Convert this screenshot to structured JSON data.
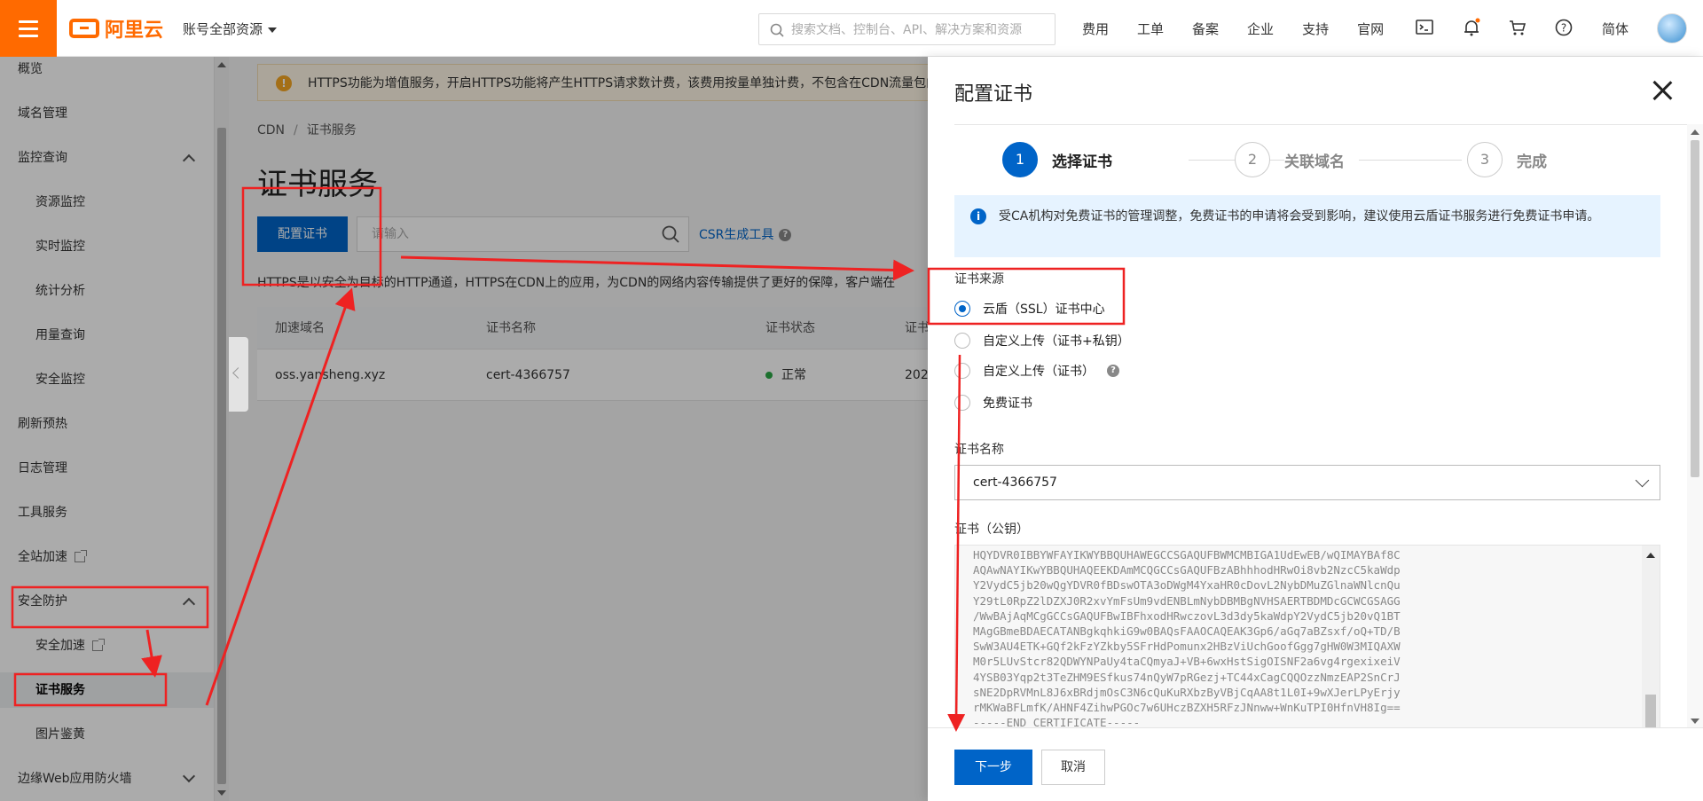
{
  "header": {
    "logo_text": "阿里云",
    "account_label": "账号全部资源",
    "search_placeholder": "搜索文档、控制台、API、解决方案和资源",
    "nav": [
      "费用",
      "工单",
      "备案",
      "企业",
      "支持",
      "官网"
    ],
    "lang": "简体",
    "accent_color": "#ff6a00"
  },
  "sidebar": {
    "items": [
      {
        "label": "概览"
      },
      {
        "label": "域名管理"
      },
      {
        "label": "监控查询"
      },
      {
        "label": "资源监控"
      },
      {
        "label": "实时监控"
      },
      {
        "label": "统计分析"
      },
      {
        "label": "用量查询"
      },
      {
        "label": "安全监控"
      },
      {
        "label": "刷新预热"
      },
      {
        "label": "日志管理"
      },
      {
        "label": "工具服务"
      },
      {
        "label": "全站加速"
      },
      {
        "label": "安全防护"
      },
      {
        "label": "安全加速"
      },
      {
        "label": "证书服务"
      },
      {
        "label": "图片鉴黄"
      },
      {
        "label": "边缘Web应用防火墙"
      }
    ]
  },
  "main": {
    "notice": "HTTPS功能为增值服务，开启HTTPS功能将产生HTTPS请求数计费，该费用按量单独计费，不包含在CDN流量包内。",
    "breadcrumb": [
      "CDN",
      "证书服务"
    ],
    "title": "证书服务",
    "config_button": "配置证书",
    "search_placeholder": "请输入",
    "csr_link": "CSR生成工具",
    "description": "HTTPS是以安全为目标的HTTP通道，HTTPS在CDN上的应用，为CDN的网络内容传输提供了更好的保障，客户端在",
    "table": {
      "headers": [
        "加速域名",
        "证书名称",
        "证书状态",
        "证书"
      ],
      "rows": [
        {
          "domain": "oss.yansheng.xyz",
          "cert": "cert-4366757",
          "status": "正常",
          "date": "202"
        }
      ]
    }
  },
  "drawer": {
    "title": "配置证书",
    "steps": [
      {
        "num": "1",
        "label": "选择证书"
      },
      {
        "num": "2",
        "label": "关联域名"
      },
      {
        "num": "3",
        "label": "完成"
      }
    ],
    "info": "受CA机构对免费证书的管理调整，免费证书的申请将会受到影响，建议使用云盾证书服务进行免费证书申请。",
    "source_label": "证书来源",
    "options": [
      "云盾（SSL）证书中心",
      "自定义上传（证书+私钥）",
      "自定义上传（证书）",
      "免费证书"
    ],
    "selected_option": "云盾（SSL）证书中心",
    "name_label": "证书名称",
    "name_value": "cert-4366757",
    "pubkey_label": "证书（公钥）",
    "cert_text": "HQYDVR0IBBYWFAYIKWYBBQUHAWEGCCSGAQUFBWMCMBIGA1UdEwEB/wQIMAYBAf8C\nAQAwNAYIKwYBBQUHAQEEKDAmMCQGCCsGAQUFBzABhhhodHRwOi8vb2NzcC5kaWdp\nY2VydC5jb20wQgYDVR0fBDswOTA3oDWgM4YxaHR0cDovL2NybDMuZGlnaWNlcnQu\nY29tL0RpZ2lDZXJ0R2xvYmFsUm9vdENBLmNybDBMBgNVHSAERTBDMDcGCWCGSAGG\n/WwBAjAqMCgGCCsGAQUFBwIBFhxodHRwczovL3d3dy5kaWdpY2VydC5jb20vQ1BT\nMAgGBmeBDAECATANBgkqhkiG9w0BAQsFAAOCAQEAK3Gp6/aGq7aBZsxf/oQ+TD/B\nSwW3AU4ETK+GQf2kFzYZkby5SFrHdPomunx2HBzViUchGoofGgg7gHW0W3MIQAXW\nM0r5LUvStcr82QDWYNPaUy4taCQmyaJ+VB+6wxHstSigOISNF2a6vg4rgexixeiV\n4YSB03Yqp2t3TeZHM9ESfkus74nQyW7pRGezj+TC44xCagCQQOzzNmzEAP2SnCrJ\nsNE2DpRVMnL8J6xBRdjmOsC3N6cQuKuRXbzByVBjCqAA8t1L0I+9wXJerLPyErjy\nrMKWaBFLmfK/AHNF4ZihwPGOc7w6UHczBZXH5RFzJNnww+WnKuTPI0HfnVH8Ig==\n-----END CERTIFICATE-----",
    "next_button": "下一步",
    "cancel_button": "取消",
    "primary_color": "#0064c8"
  },
  "annotation_color": "#ee2222"
}
